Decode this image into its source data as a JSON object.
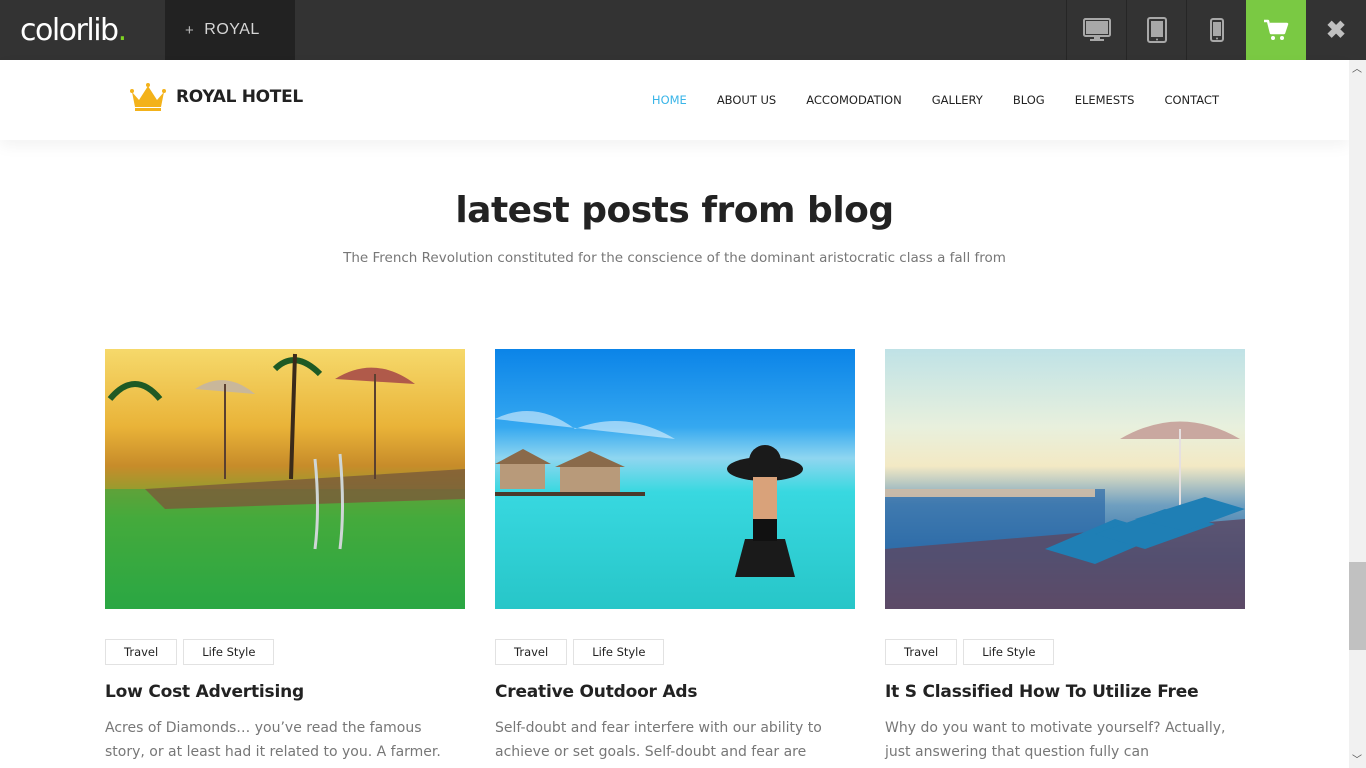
{
  "topbar": {
    "brand": "colorlib",
    "brand_dot": ".",
    "theme_label": "ROYAL",
    "plus": "+"
  },
  "site": {
    "logo_text": "ROYAL HOTEL",
    "nav": [
      {
        "label": "HOME",
        "active": true
      },
      {
        "label": "ABOUT US"
      },
      {
        "label": "ACCOMODATION"
      },
      {
        "label": "GALLERY"
      },
      {
        "label": "BLOG"
      },
      {
        "label": "ELEMESTS"
      },
      {
        "label": "CONTACT"
      }
    ]
  },
  "section": {
    "title": "latest posts from blog",
    "subtitle": "The French Revolution constituted for the conscience of the dominant aristocratic class a fall from"
  },
  "posts": [
    {
      "tags": [
        "Travel",
        "Life Style"
      ],
      "title": "Low Cost Advertising",
      "excerpt": "Acres of Diamonds… you’ve read the famous story, or at least had it related to you. A farmer."
    },
    {
      "tags": [
        "Travel",
        "Life Style"
      ],
      "title": "Creative Outdoor Ads",
      "excerpt": "Self-doubt and fear interfere with our ability to achieve or set goals. Self-doubt and fear are"
    },
    {
      "tags": [
        "Travel",
        "Life Style"
      ],
      "title": "It S Classified How To Utilize Free",
      "excerpt": "Why do you want to motivate yourself? Actually, just answering that question fully can"
    }
  ],
  "colors": {
    "accent": "#3ab5e8",
    "cart": "#7ac943",
    "topbar": "#333333",
    "logo_crown": "#f3b21a"
  }
}
